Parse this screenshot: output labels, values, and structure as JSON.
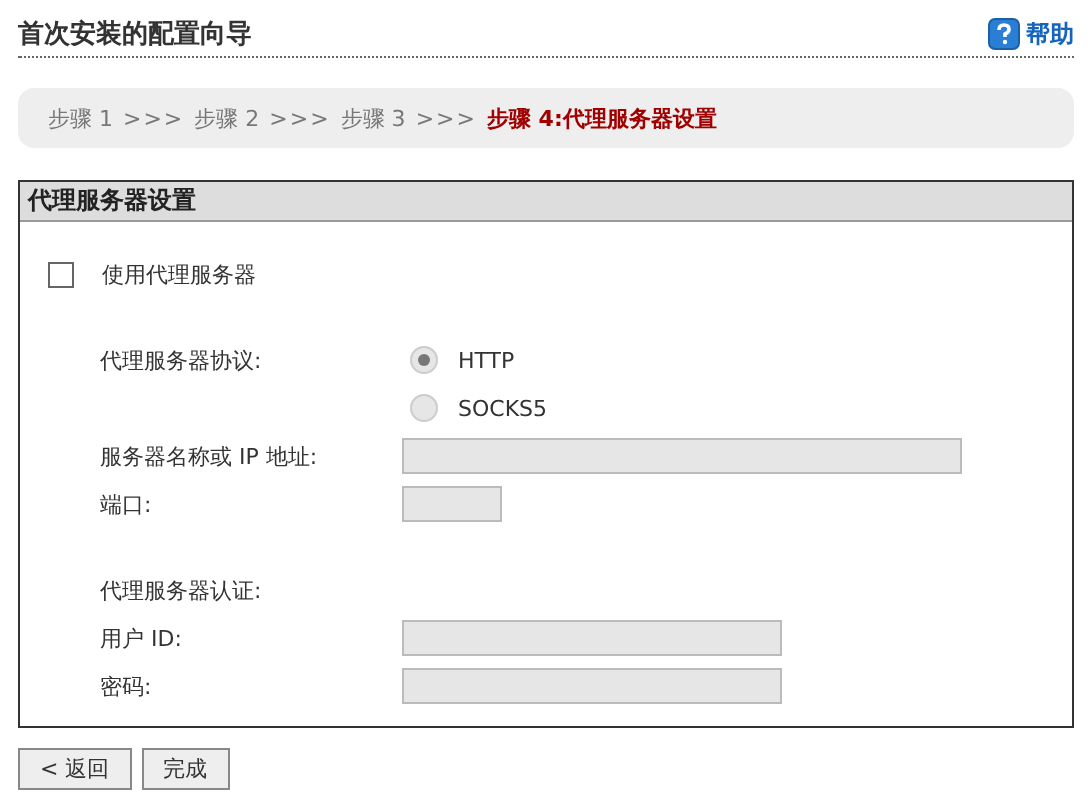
{
  "header": {
    "title": "首次安装的配置向导",
    "help": "帮助"
  },
  "breadcrumb": [
    {
      "label": "步骤 1",
      "kind": "step",
      "selected": false
    },
    {
      "label": ">>>",
      "kind": "separator"
    },
    {
      "label": "步骤 2",
      "kind": "step",
      "selected": false
    },
    {
      "label": ">>>",
      "kind": "separator"
    },
    {
      "label": "步骤 3",
      "kind": "step",
      "selected": false
    },
    {
      "label": ">>>",
      "kind": "separator"
    },
    {
      "label": "步骤 4:代理服务器设置",
      "kind": "step",
      "selected": true
    }
  ],
  "panel": {
    "title": "代理服务器设置",
    "use_proxy": {
      "label": "使用代理服务器",
      "checked": false
    },
    "protocol": {
      "label": "代理服务器协议:",
      "options": [
        {
          "label": "HTTP",
          "selected": true,
          "disabled": true
        },
        {
          "label": "SOCKS5",
          "selected": false,
          "disabled": true
        }
      ]
    },
    "rows": [
      {
        "kind": "wide",
        "label": "服务器名称或 IP 地址:",
        "disabled": true
      },
      {
        "kind": "short",
        "label": "端口:",
        "disabled": true
      },
      {
        "kind": "heading",
        "label": "代理服务器认证:"
      },
      {
        "kind": "medium",
        "label": "用户 ID:",
        "disabled": true
      },
      {
        "kind": "medium",
        "label": "密码:",
        "disabled": true
      }
    ]
  },
  "buttons": [
    "< 返回",
    "完成"
  ]
}
